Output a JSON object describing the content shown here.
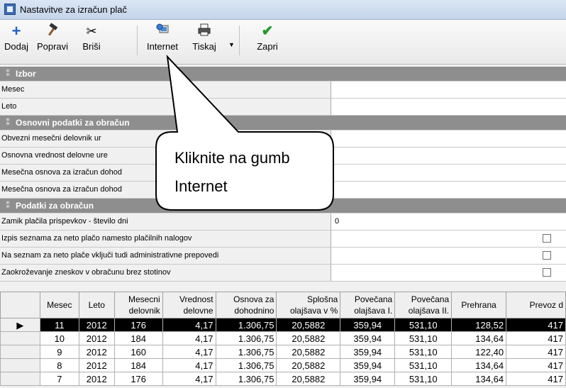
{
  "window": {
    "title": "Nastavitve za izračun plač"
  },
  "toolbar": {
    "add": "Dodaj",
    "edit": "Popravi",
    "delete": "Briši",
    "internet": "Internet",
    "print": "Tiskaj",
    "close": "Zapri"
  },
  "sections": {
    "izbor": "Izbor",
    "osnovni": "Osnovni podatki za obračun",
    "podatki": "Podatki za obračun"
  },
  "izbor": {
    "month": "Mesec",
    "year": "Leto"
  },
  "osnovni": {
    "r1": "Obvezni mesečni delovnik ur",
    "r2": "Osnovna vrednost delovne ure",
    "r3": "Mesečna osnova za izračun dohod",
    "r4": "Mesečna osnova za izračun dohod"
  },
  "podatki": {
    "r1": "Zamik plačila prispevkov - število dni",
    "r1_value": "0",
    "r2": "Izpis seznama za neto plačo namesto plačilnih nalogov",
    "r3": "Na seznam za neto plače vključi tudi administrativne prepovedi",
    "r4": "Zaokroževanje zneskov v obračunu brez stotinov"
  },
  "table": {
    "headers": [
      "Mesec",
      "Leto",
      "Mesecni delovnik",
      "Vrednost delovne",
      "Osnova za dohodnino",
      "Splošna olajšava v %",
      "Povečana olajšava I.",
      "Povečana olajšava II.",
      "Prehrana",
      "Prevoz d"
    ],
    "current_marker": "▶",
    "rows": [
      [
        "11",
        "2012",
        "176",
        "4,17",
        "1.306,75",
        "20,5882",
        "359,94",
        "531,10",
        "128,52",
        "417"
      ],
      [
        "10",
        "2012",
        "184",
        "4,17",
        "1.306,75",
        "20,5882",
        "359,94",
        "531,10",
        "134,64",
        "417"
      ],
      [
        "9",
        "2012",
        "160",
        "4,17",
        "1.306,75",
        "20,5882",
        "359,94",
        "531,10",
        "122,40",
        "417"
      ],
      [
        "8",
        "2012",
        "184",
        "4,17",
        "1.306,75",
        "20,5882",
        "359,94",
        "531,10",
        "134,64",
        "417"
      ],
      [
        "7",
        "2012",
        "176",
        "4,17",
        "1.306,75",
        "20,5882",
        "359,94",
        "531,10",
        "134,64",
        "417"
      ]
    ]
  },
  "callout": {
    "line1": "Kliknite na gumb",
    "line2": "Internet"
  }
}
